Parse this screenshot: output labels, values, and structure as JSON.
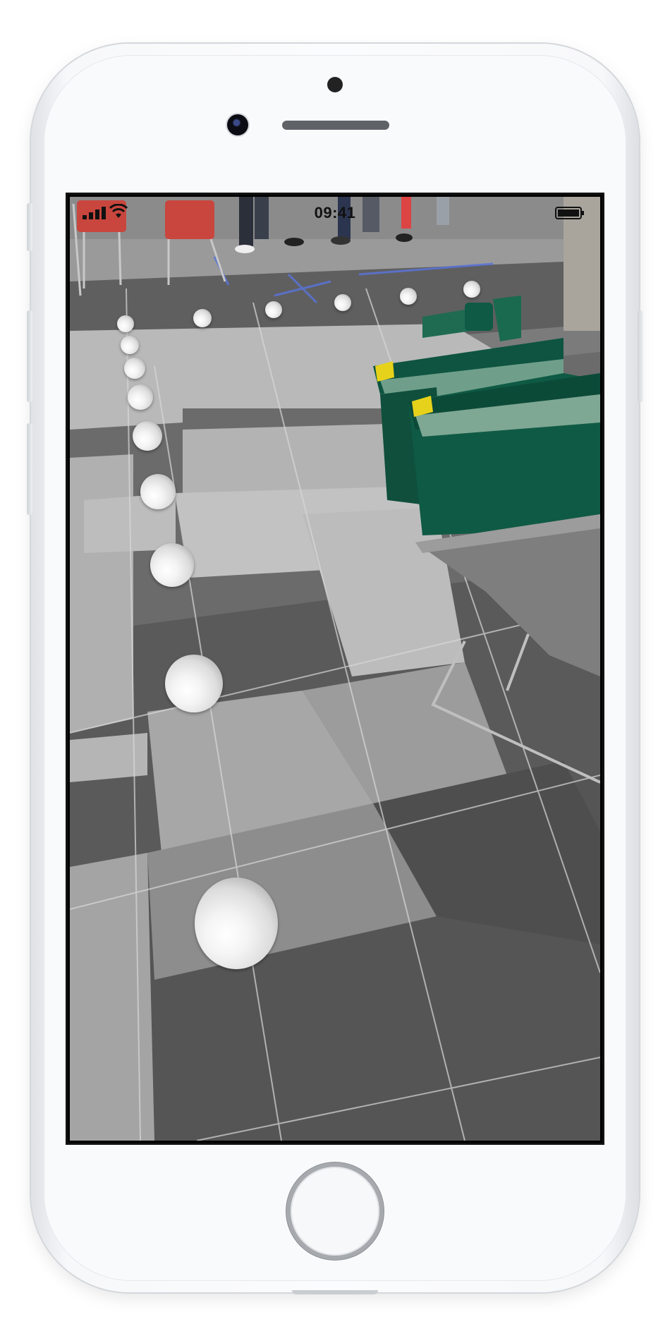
{
  "device": "iPhone",
  "status_bar": {
    "time": "09:41",
    "signal_icon": "cellular-signal-icon",
    "wifi_icon": "wifi-icon",
    "battery_icon": "battery-icon"
  },
  "ar_view": {
    "scene": "camera-feed",
    "object_icon": "sphere"
  },
  "colors": {
    "frame": "#f7f8fa",
    "screen_border": "#121212",
    "floor_dark": "#5c5c5c",
    "floor_light": "#b5b5b5",
    "bin_green": "#0f5a44",
    "bin_lid_yellow": "#e6d21a",
    "chair_red": "#c9463e"
  }
}
